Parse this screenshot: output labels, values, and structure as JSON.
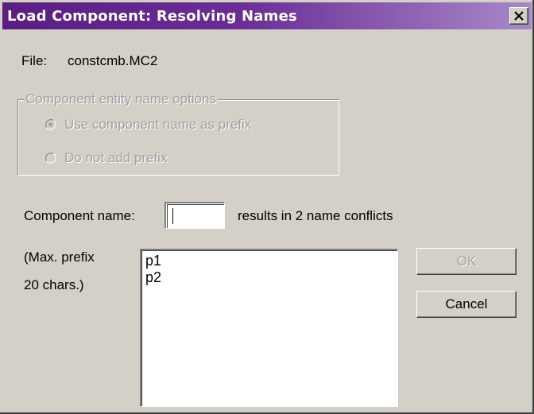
{
  "window": {
    "title": "Load Component: Resolving Names",
    "close_icon": "close-icon"
  },
  "file": {
    "label": "File:",
    "value": "constcmb.MC2"
  },
  "options_group": {
    "legend": "Component entity name options",
    "enabled": false,
    "options": [
      {
        "label": "Use component name as prefix",
        "selected": true
      },
      {
        "label": "Do not add prefix",
        "selected": false
      }
    ]
  },
  "component_name": {
    "label": "Component name:",
    "value": "",
    "status": "results in 2 name conflicts"
  },
  "prefix_note": {
    "line1": "(Max. prefix",
    "line2": "20 chars.)"
  },
  "conflicts": [
    "p1",
    "p2"
  ],
  "buttons": {
    "ok_label": "OK",
    "ok_enabled": false,
    "cancel_label": "Cancel"
  },
  "colors": {
    "titlebar_start": "#5a1e82",
    "titlebar_end": "#a888c8",
    "face": "#d4d0c8",
    "disabled_text": "#a0a0a0"
  }
}
